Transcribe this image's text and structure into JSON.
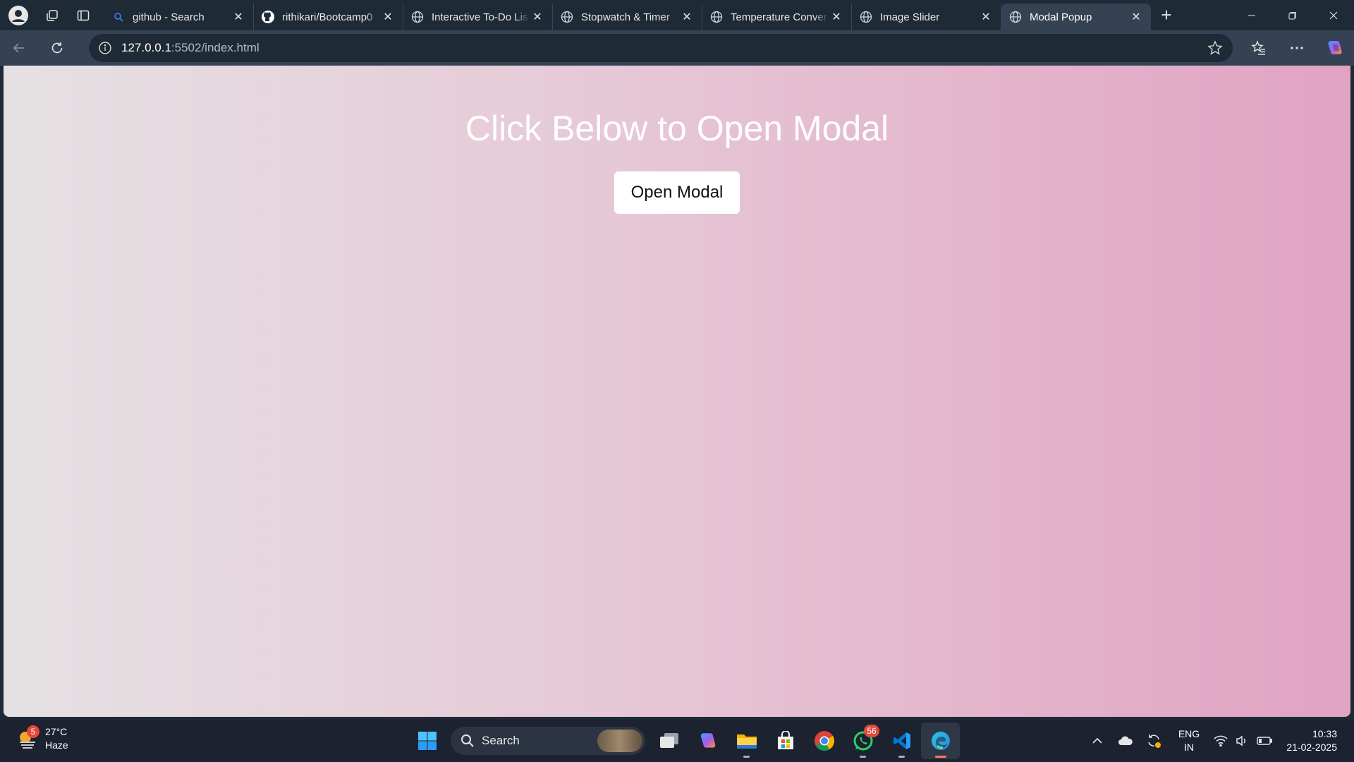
{
  "browser": {
    "tabs": [
      {
        "title": "github - Search",
        "favicon": "search-icon",
        "active": false
      },
      {
        "title": "rithikari/Bootcamp0",
        "favicon": "github-icon",
        "active": false
      },
      {
        "title": "Interactive To-Do Lis",
        "favicon": "globe-icon",
        "active": false
      },
      {
        "title": "Stopwatch & Timer",
        "favicon": "globe-icon",
        "active": false
      },
      {
        "title": "Temperature Conver",
        "favicon": "globe-icon",
        "active": false
      },
      {
        "title": "Image Slider",
        "favicon": "globe-icon",
        "active": false
      },
      {
        "title": "Modal Popup",
        "favicon": "globe-icon",
        "active": true
      }
    ],
    "address": {
      "host": "127.0.0.1",
      "rest": ":5502/index.html"
    }
  },
  "page": {
    "heading": "Click Below to Open Modal",
    "button_label": "Open Modal",
    "gradient": {
      "start": "#e5e1e3",
      "end": "#e1a3c2"
    }
  },
  "taskbar": {
    "weather": {
      "badge": "5",
      "temp": "27°C",
      "condition": "Haze"
    },
    "search_label": "Search",
    "whatsapp_badge": "56",
    "apps": [
      "start-icon",
      "search",
      "task-view-icon",
      "copilot-icon",
      "file-explorer-icon",
      "store-icon",
      "chrome-icon",
      "whatsapp-icon",
      "vscode-icon",
      "edge-icon"
    ],
    "lang": {
      "line1": "ENG",
      "line2": "IN"
    },
    "clock": {
      "time": "10:33",
      "date": "21-02-2025"
    }
  }
}
